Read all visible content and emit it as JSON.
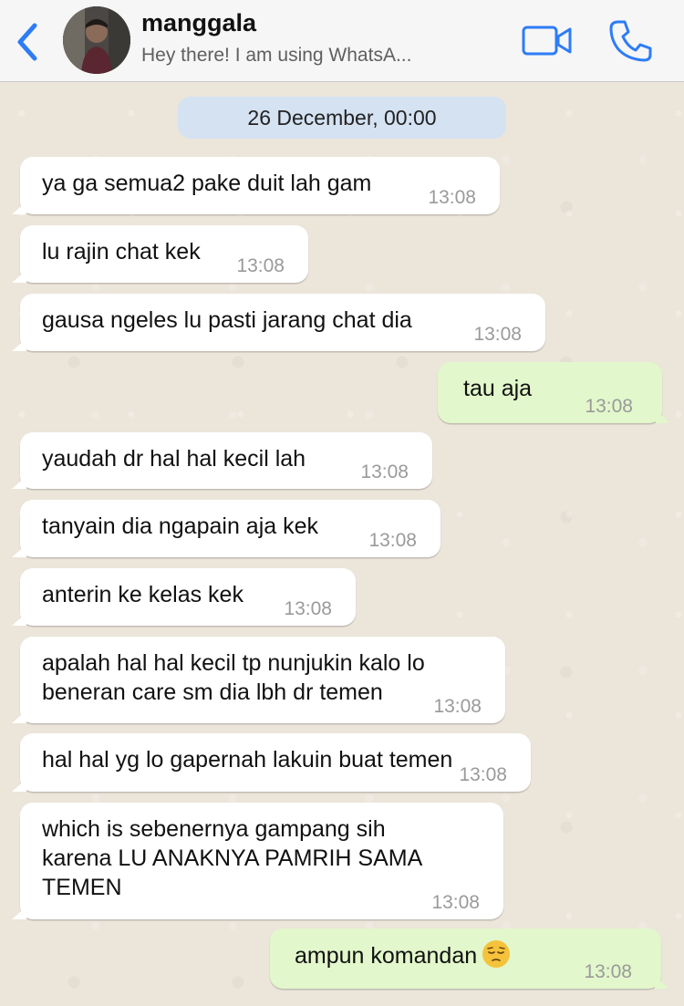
{
  "header": {
    "contact_name": "manggala",
    "contact_status": "Hey there! I am using WhatsA...",
    "back_icon": "chevron-left-icon",
    "video_icon": "video-camera-icon",
    "call_icon": "phone-icon",
    "accent_color": "#2e7cf6"
  },
  "chat": {
    "date_chip": "26 December, 00:00",
    "messages": [
      {
        "dir": "in",
        "text": "ya ga semua2 pake duit lah gam",
        "time": "13:08"
      },
      {
        "dir": "in",
        "text": "lu rajin chat kek",
        "time": "13:08"
      },
      {
        "dir": "in",
        "text": "gausa ngeles lu pasti jarang chat dia",
        "time": "13:08"
      },
      {
        "dir": "out",
        "text": "tau aja",
        "time": "13:08"
      },
      {
        "dir": "in",
        "text": "yaudah dr hal hal kecil lah",
        "time": "13:08"
      },
      {
        "dir": "in",
        "text": "tanyain dia ngapain aja kek",
        "time": "13:08"
      },
      {
        "dir": "in",
        "text": "anterin ke kelas kek",
        "time": "13:08"
      },
      {
        "dir": "in",
        "text_lines": [
          "apalah hal hal kecil tp nunjukin kalo lo",
          "beneran care sm dia lbh dr temen"
        ],
        "time": "13:08"
      },
      {
        "dir": "in",
        "text": "hal hal yg lo gapernah lakuin buat temen",
        "time": "13:08"
      },
      {
        "dir": "in",
        "text_lines": [
          "which is sebenernya gampang sih",
          "karena LU ANAKNYA PAMRIH SAMA",
          "TEMEN"
        ],
        "time": "13:08"
      },
      {
        "dir": "out",
        "text": "ampun komandan",
        "emoji": "pensive-face-icon",
        "time": "13:08"
      }
    ],
    "colors": {
      "incoming_bubble": "#ffffff",
      "outgoing_bubble": "#e2f7cb",
      "date_chip": "#d4e2f2",
      "wallpaper": "#ebe5da"
    }
  }
}
